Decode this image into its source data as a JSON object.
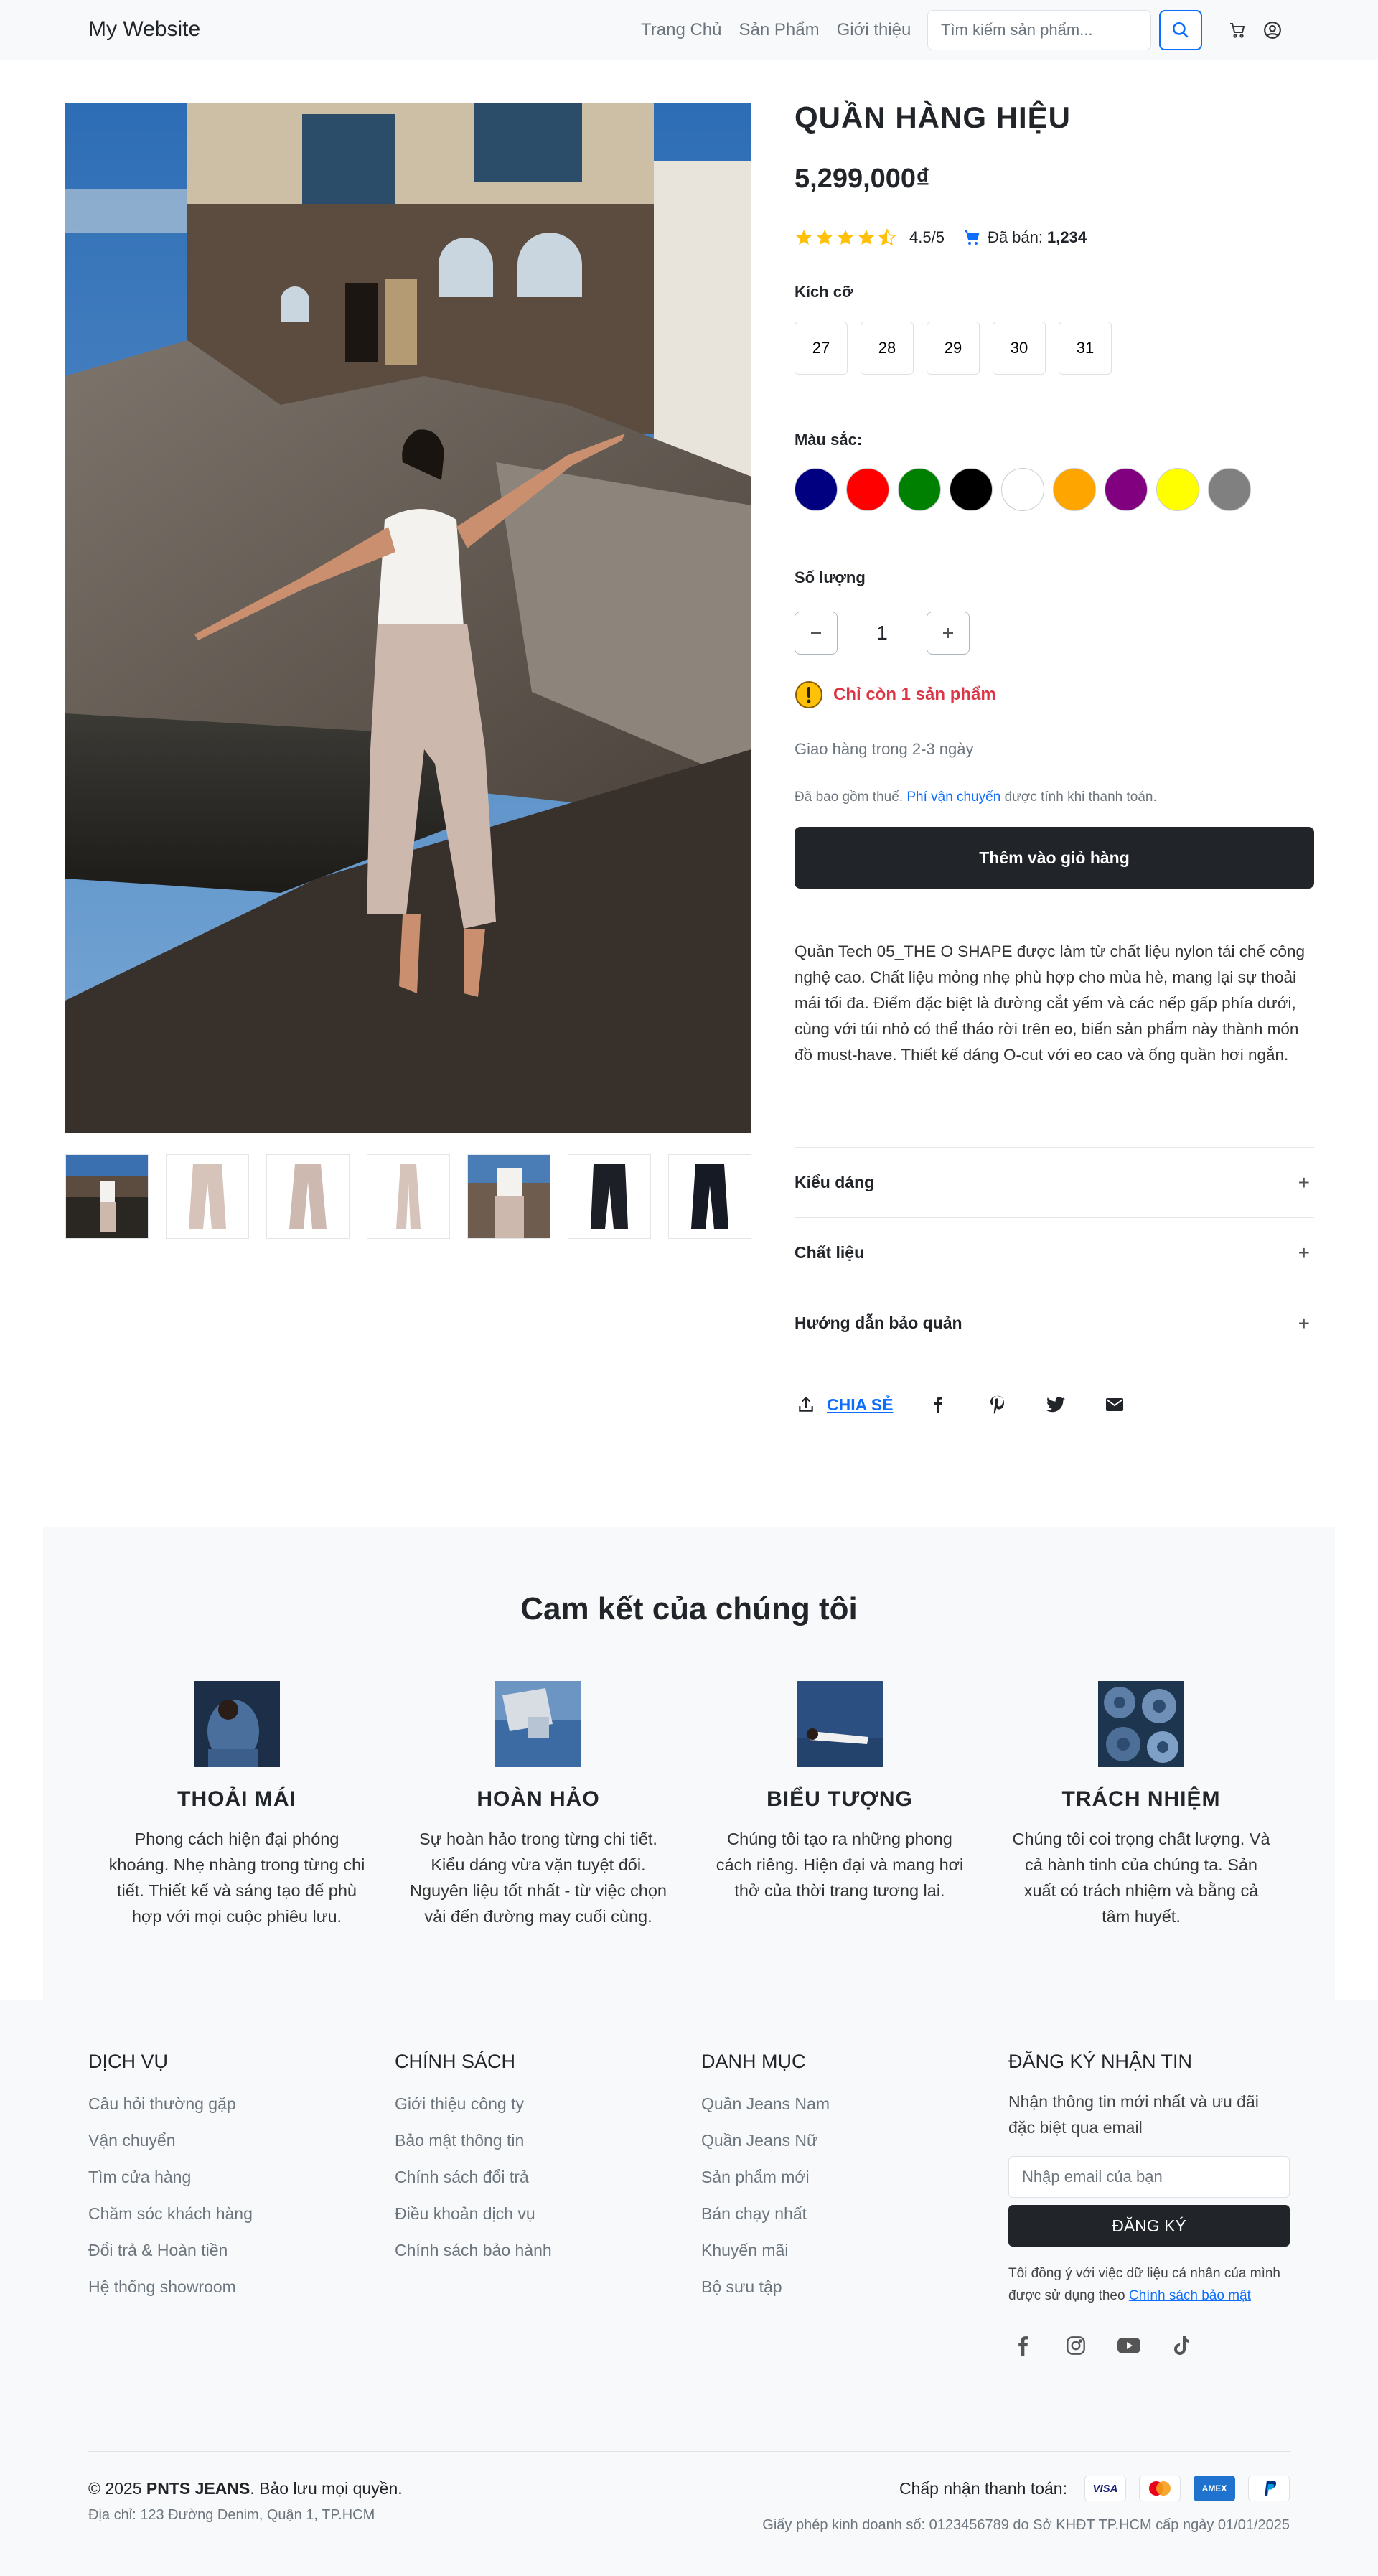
{
  "navbar": {
    "brand": "My Website",
    "links": [
      "Trang Chủ",
      "Sản Phẩm",
      "Giới thiệu"
    ],
    "search_placeholder": "Tìm kiếm sản phẩm..."
  },
  "product": {
    "title": "QUẦN HÀNG HIỆU",
    "price": "5,299,000₫",
    "rating": "4.5/5",
    "rating_value": 4.5,
    "sold_label": "Đã bán:",
    "sold_count": "1,234",
    "size_label": "Kích cỡ",
    "sizes": [
      "27",
      "28",
      "29",
      "30",
      "31"
    ],
    "color_label": "Màu sắc:",
    "colors": [
      "#000080",
      "#ff0000",
      "#008000",
      "#000000",
      "#ffffff",
      "#ffa500",
      "#800080",
      "#ffff00",
      "#808080"
    ],
    "quantity_label": "Số lượng",
    "quantity": "1",
    "stock_warning": "Chỉ còn 1 sản phẩm",
    "shipping": "Giao hàng trong 2-3 ngày",
    "tax_before": "Đã bao gồm thuế.",
    "tax_link": "Phí vận chuyển",
    "tax_after": "được tính khi thanh toán.",
    "add_to_cart": "Thêm vào giỏ hàng",
    "description": "Quần Tech 05_THE O SHAPE được làm từ chất liệu nylon tái chế công nghệ cao. Chất liệu mỏng nhẹ phù hợp cho mùa hè, mang lại sự thoải mái tối đa. Điểm đặc biệt là đường cắt yếm và các nếp gấp phía dưới, cùng với túi nhỏ có thể tháo rời trên eo, biến sản phẩm này thành món đồ must-have. Thiết kế dáng O-cut với eo cao và ống quần hơi ngắn.",
    "accordion": [
      "Kiểu dáng",
      "Chất liệu",
      "Hướng dẫn bảo quản"
    ],
    "share_label": "CHIA SẺ"
  },
  "commitment": {
    "title": "Cam kết của chúng tôi",
    "items": [
      {
        "title": "THOẢI MÁI",
        "text": "Phong cách hiện đại phóng khoáng. Nhẹ nhàng trong từng chi tiết. Thiết kế và sáng tạo để phù hợp với mọi cuộc phiêu lưu."
      },
      {
        "title": "HOÀN HẢO",
        "text": "Sự hoàn hảo trong từng chi tiết. Kiểu dáng vừa vặn tuyệt đối. Nguyên liệu tốt nhất - từ việc chọn vải đến đường may cuối cùng."
      },
      {
        "title": "BIỂU TƯỢNG",
        "text": "Chúng tôi tạo ra những phong cách riêng. Hiện đại và mang hơi thở của thời trang tương lai."
      },
      {
        "title": "TRÁCH NHIỆM",
        "text": "Chúng tôi coi trọng chất lượng. Và cả hành tinh của chúng ta. Sản xuất có trách nhiệm và bằng cả tâm huyết."
      }
    ]
  },
  "footer": {
    "services": {
      "title": "DỊCH VỤ",
      "links": [
        "Câu hỏi thường gặp",
        "Vận chuyển",
        "Tìm cửa hàng",
        "Chăm sóc khách hàng",
        "Đổi trả & Hoàn tiền",
        "Hệ thống showroom"
      ]
    },
    "policies": {
      "title": "CHÍNH SÁCH",
      "links": [
        "Giới thiệu công ty",
        "Bảo mật thông tin",
        "Chính sách đổi trả",
        "Điều khoản dịch vụ",
        "Chính sách bảo hành"
      ]
    },
    "categories": {
      "title": "DANH MỤC",
      "links": [
        "Quần Jeans Nam",
        "Quần Jeans Nữ",
        "Sản phẩm mới",
        "Bán chạy nhất",
        "Khuyến mãi",
        "Bộ sưu tập"
      ]
    },
    "newsletter": {
      "title": "ĐĂNG KÝ NHẬN TIN",
      "text": "Nhận thông tin mới nhất và ưu đãi đặc biệt qua email",
      "placeholder": "Nhập email của bạn",
      "button": "ĐĂNG KÝ",
      "consent": "Tôi đồng ý với việc dữ liệu cá nhân của mình được sử dụng theo",
      "consent_link": "Chính sách bảo mật"
    },
    "copyright_prefix": "© 2025",
    "copyright_brand": "PNTS JEANS",
    "copyright_suffix": ". Bảo lưu mọi quyền.",
    "address": "Địa chỉ: 123 Đường Denim, Quận 1, TP.HCM",
    "payment_label": "Chấp nhận thanh toán:",
    "cards": [
      "VISA",
      "AMEX"
    ],
    "license": "Giấy phép kinh doanh số: 0123456789 do Sở KHĐT TP.HCM cấp ngày 01/01/2025"
  }
}
